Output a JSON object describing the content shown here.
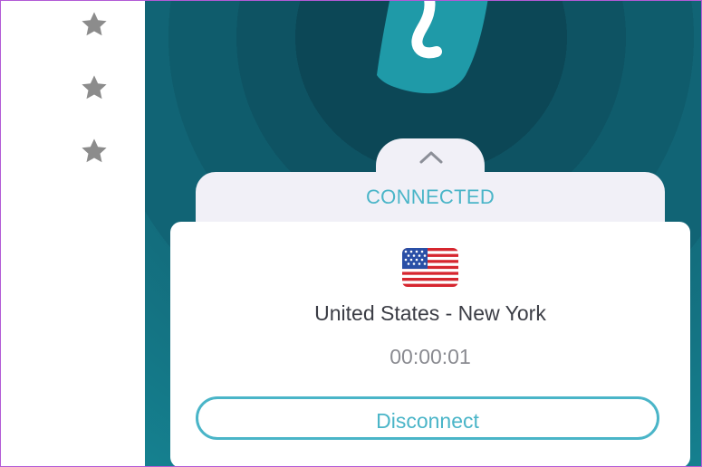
{
  "favorites": {
    "icon": "star-icon",
    "count": 3,
    "color": "#8c8c8c"
  },
  "brand": {
    "logo": "surfshark-logo",
    "color": "#1f9aa8"
  },
  "status": {
    "label": "CONNECTED",
    "color": "#4ab5c8",
    "expand_icon": "chevron-up-icon"
  },
  "connection": {
    "flag_icon": "us-flag-icon",
    "location": "United States - New York",
    "elapsed": "00:00:01"
  },
  "actions": {
    "disconnect_label": "Disconnect"
  }
}
